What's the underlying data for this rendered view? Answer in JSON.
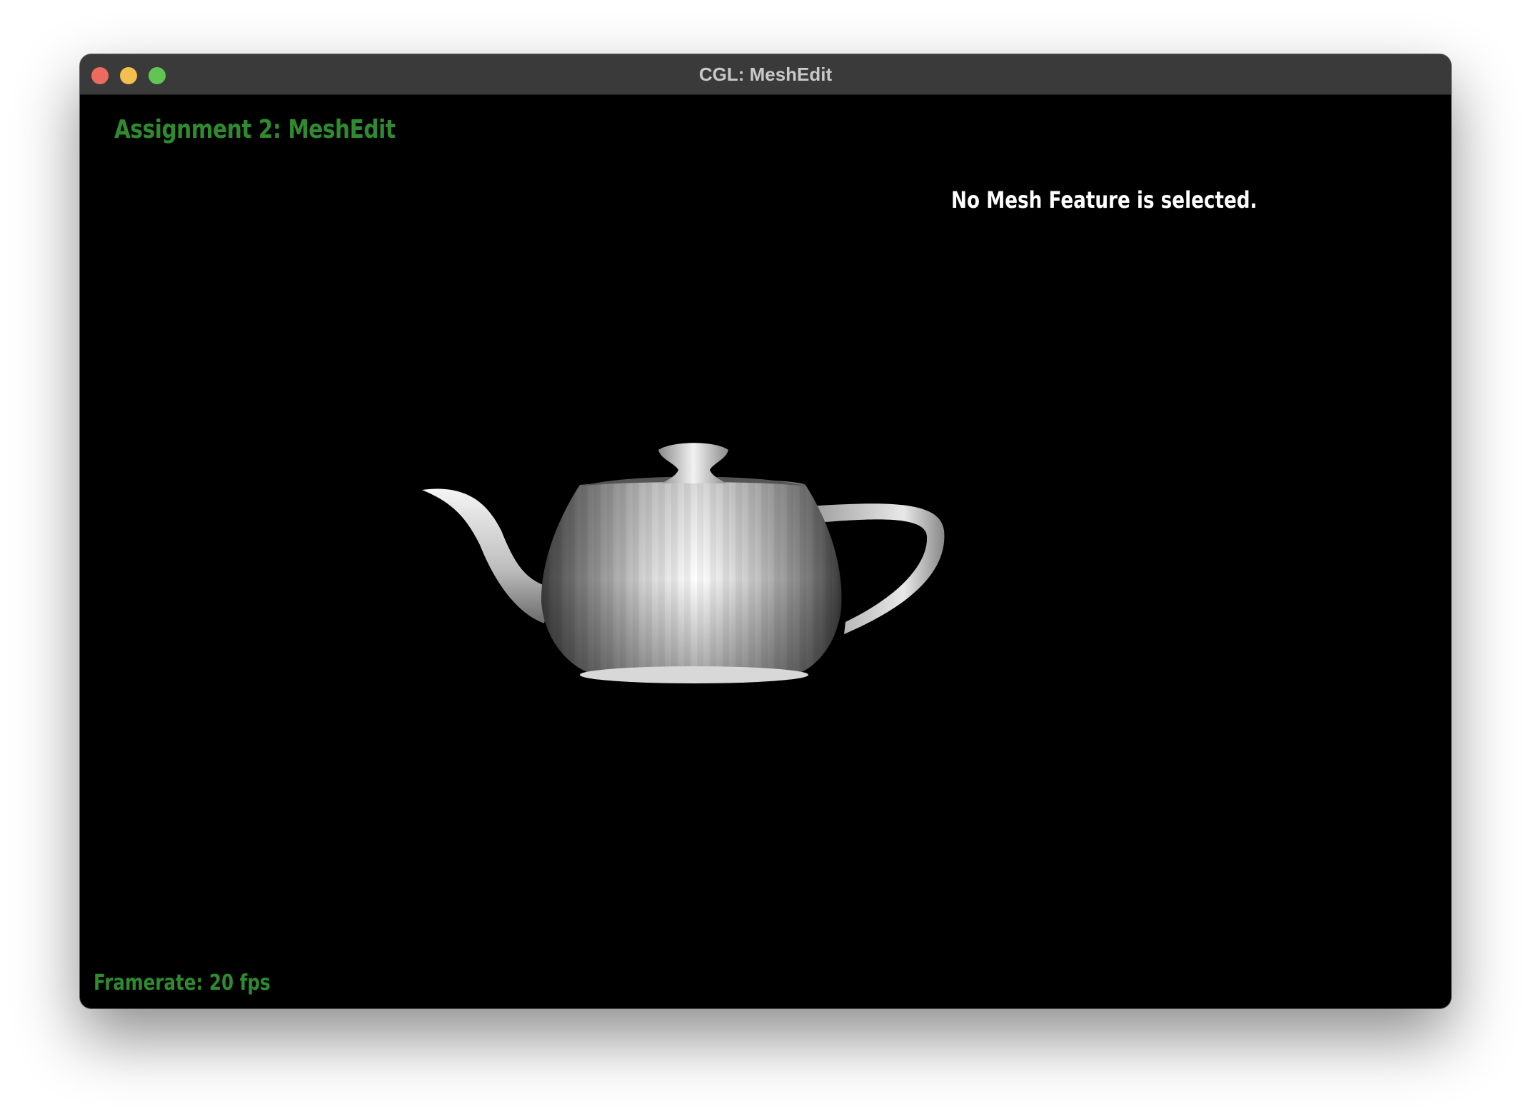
{
  "window": {
    "title": "CGL: MeshEdit"
  },
  "hud": {
    "assignment_title": "Assignment 2: MeshEdit",
    "selection_status": "No Mesh Feature is selected.",
    "framerate": "Framerate: 20 fps"
  },
  "colors": {
    "background": "#000000",
    "hud_green": "#2e8b2e",
    "hud_white": "#ffffff",
    "titlebar": "#3a3a3a",
    "traffic_close": "#ed6a5e",
    "traffic_minimize": "#f5bf4f",
    "traffic_zoom": "#61c554"
  },
  "icons": {
    "close": "close-button-icon",
    "minimize": "minimize-button-icon",
    "zoom": "zoom-button-icon"
  },
  "scene": {
    "object": "teapot",
    "shading": "flat"
  }
}
